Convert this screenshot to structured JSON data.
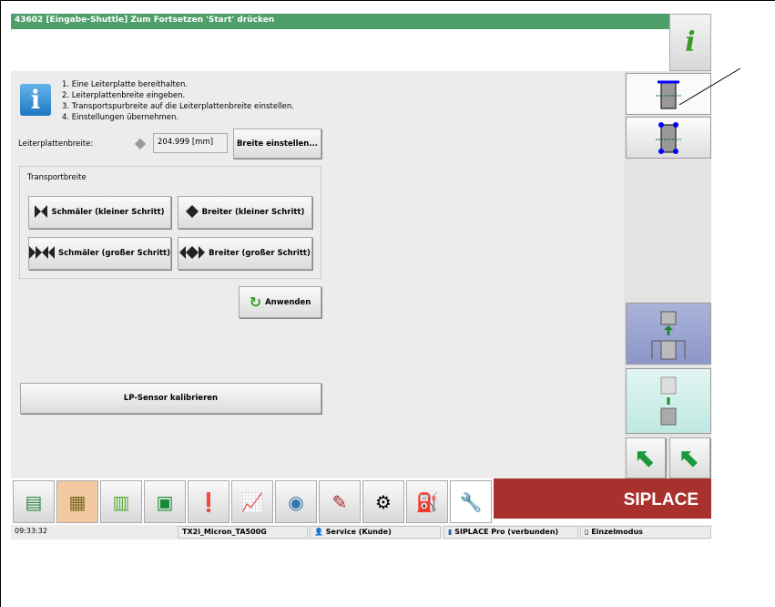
{
  "header": {
    "message": "43602 [Eingabe-Shuttle] Zum Fortsetzen 'Start' drücken",
    "info_label": "i"
  },
  "instructions": [
    "1. Eine Leiterplatte bereithalten.",
    "2. Leiterplattenbreite eingeben.",
    "3. Transportspurbreite auf die Leiterplattenbreite einstellen.",
    "4. Einstellungen übernehmen."
  ],
  "width": {
    "label": "Leiterplattenbreite:",
    "value": "204.999 [mm]",
    "set_button": "Breite einstellen..."
  },
  "transport": {
    "title": "Transportbreite",
    "narrow_small": "Schmäler (kleiner Schritt)",
    "wide_small": "Breiter (kleiner Schritt)",
    "narrow_large": "Schmäler (großer Schritt)",
    "wide_large": "Breiter (großer Schritt)"
  },
  "apply_button": "Anwenden",
  "calibrate_button": "LP-Sensor kalibrieren",
  "brand": "SIPLACE",
  "status": {
    "time": "09:33:32",
    "machine": "TX2i_Micron_TA500G",
    "user": "Service (Kunde)",
    "connection": "SIPLACE Pro (verbunden)",
    "mode": "Einzelmodus"
  },
  "colors": {
    "header": "#4e9f6a",
    "brand": "#a8302d"
  }
}
